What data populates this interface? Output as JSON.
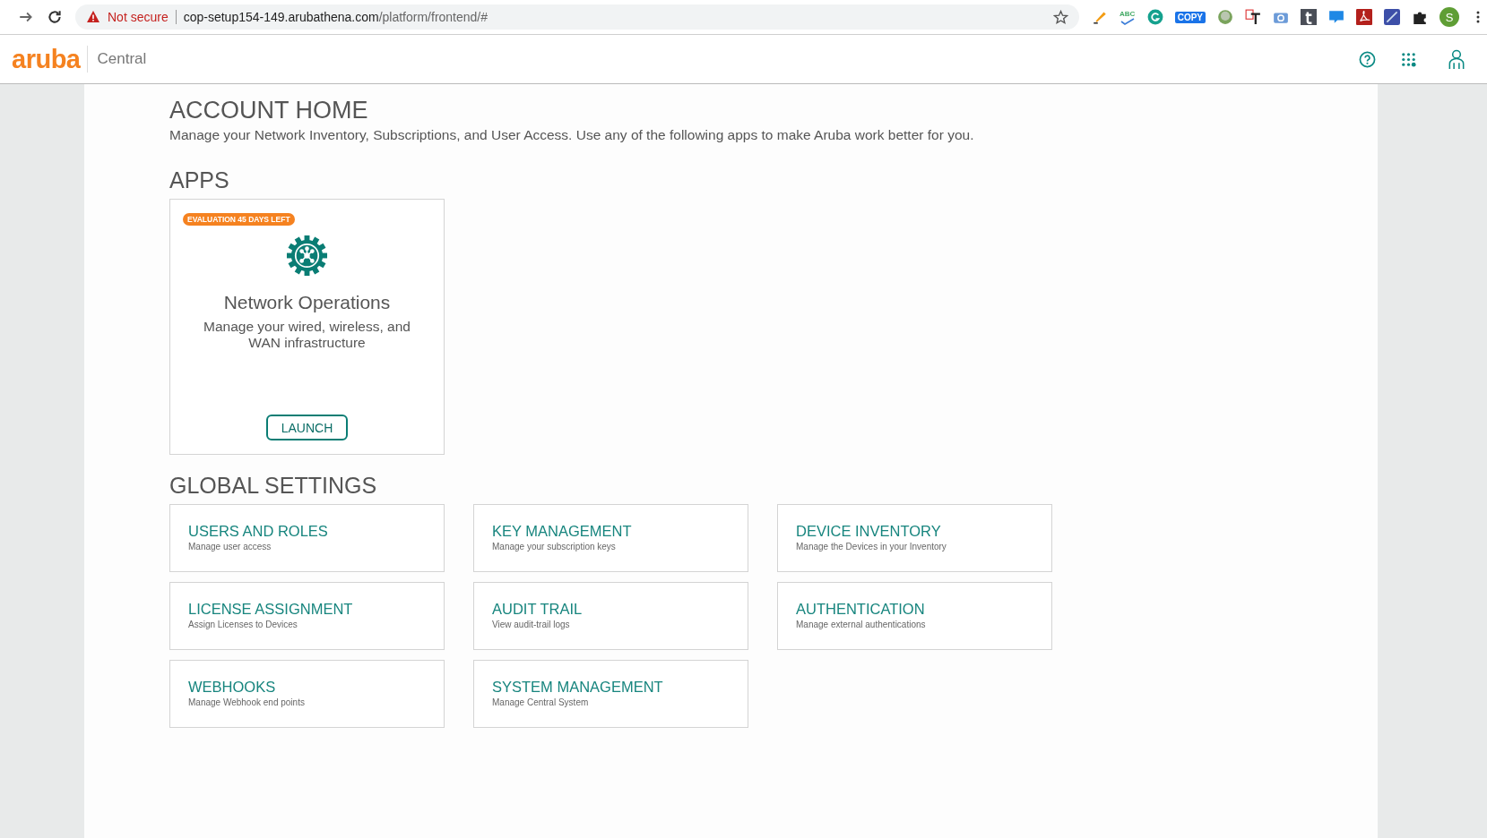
{
  "browser": {
    "security_label": "Not secure",
    "url_host": "cop-setup154-149.arubathena.com",
    "url_path": "/platform/frontend/#",
    "spell_label": "ABC",
    "copy_label": "COPY",
    "profile_initial": "S"
  },
  "header": {
    "logo": "aruba",
    "product": "Central"
  },
  "account": {
    "title": "ACCOUNT HOME",
    "description": "Manage your Network Inventory, Subscriptions, and User Access. Use any of the following apps to make Aruba work better for you."
  },
  "apps": {
    "title": "APPS",
    "cards": [
      {
        "badge": "EVALUATION 45 DAYS LEFT",
        "name": "Network Operations",
        "description": "Manage your wired, wireless, and WAN infrastructure",
        "button": "LAUNCH"
      }
    ]
  },
  "global_settings": {
    "title": "GLOBAL SETTINGS",
    "tiles": [
      {
        "title": "USERS AND ROLES",
        "subtitle": "Manage user access"
      },
      {
        "title": "KEY MANAGEMENT",
        "subtitle": "Manage your subscription keys"
      },
      {
        "title": "DEVICE INVENTORY",
        "subtitle": "Manage the Devices in your Inventory"
      },
      {
        "title": "LICENSE ASSIGNMENT",
        "subtitle": "Assign Licenses to Devices"
      },
      {
        "title": "AUDIT TRAIL",
        "subtitle": "View audit-trail logs"
      },
      {
        "title": "AUTHENTICATION",
        "subtitle": "Manage external authentications"
      },
      {
        "title": "WEBHOOKS",
        "subtitle": "Manage Webhook end points"
      },
      {
        "title": "SYSTEM MANAGEMENT",
        "subtitle": "Manage Central System"
      }
    ]
  }
}
